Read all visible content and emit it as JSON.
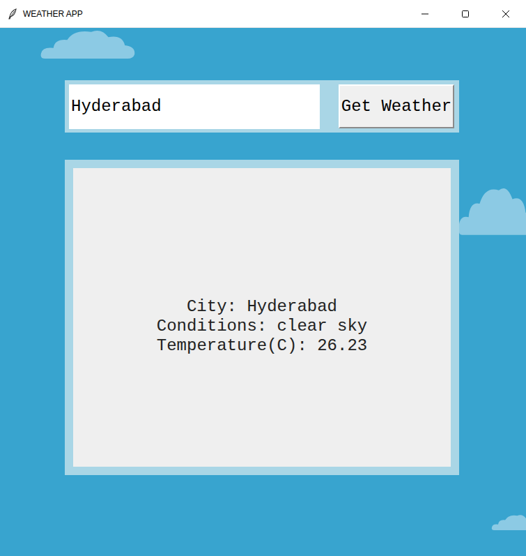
{
  "window": {
    "title": "WEATHER APP"
  },
  "search": {
    "value": "Hyderabad"
  },
  "button": {
    "label": "Get Weather"
  },
  "result": {
    "lines": [
      "City: Hyderabad",
      "Conditions: clear sky",
      "Temperature(C): 26.23"
    ]
  }
}
